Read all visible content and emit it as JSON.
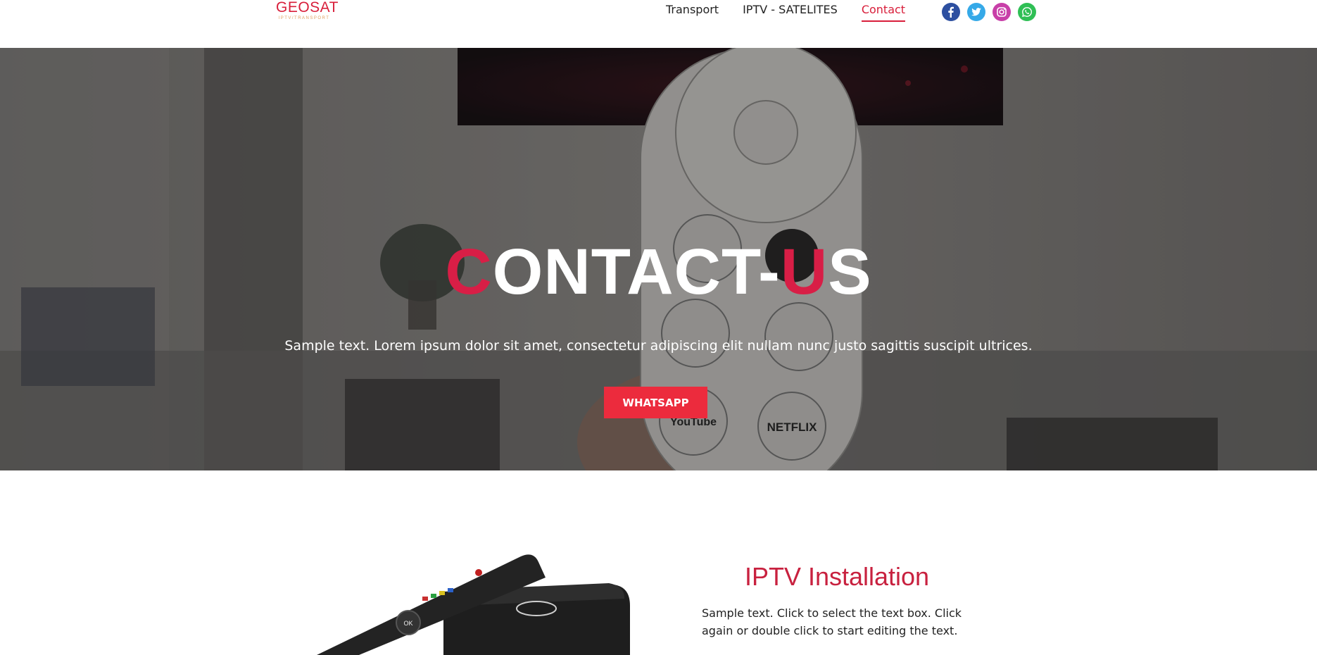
{
  "header": {
    "logo": {
      "title": "GEOSAT",
      "subtitle": "IPTV/TRANSPORT"
    },
    "nav": [
      {
        "label": "Transport",
        "active": false
      },
      {
        "label": "IPTV - SATELITES",
        "active": false
      },
      {
        "label": "Contact",
        "active": true
      }
    ],
    "socials": [
      {
        "name": "facebook-icon",
        "color": "#2d4fa0"
      },
      {
        "name": "twitter-icon",
        "color": "#35a9e8"
      },
      {
        "name": "instagram-icon",
        "color": "#c83fa8"
      },
      {
        "name": "whatsapp-icon",
        "color": "#2fbf55"
      }
    ]
  },
  "hero": {
    "title_first_letter": "C",
    "title_middle": "ONTACT-",
    "title_accent": "U",
    "title_last": "S",
    "subtitle": "Sample text. Lorem ipsum dolor sit amet, consectetur adipiscing elit nullam nunc justo sagittis suscipit ultrices.",
    "button_label": "WHATSAPP",
    "remote_labels": {
      "netflix": "NETFLIX",
      "youtube": "YouTube"
    }
  },
  "section": {
    "title": "IPTV Installation",
    "text": "Sample text. Click to select the text box. Click again or double click to start editing the text.",
    "device_button": "OK"
  },
  "colors": {
    "accent": "#d81e3a",
    "button": "#ec2b3d"
  }
}
